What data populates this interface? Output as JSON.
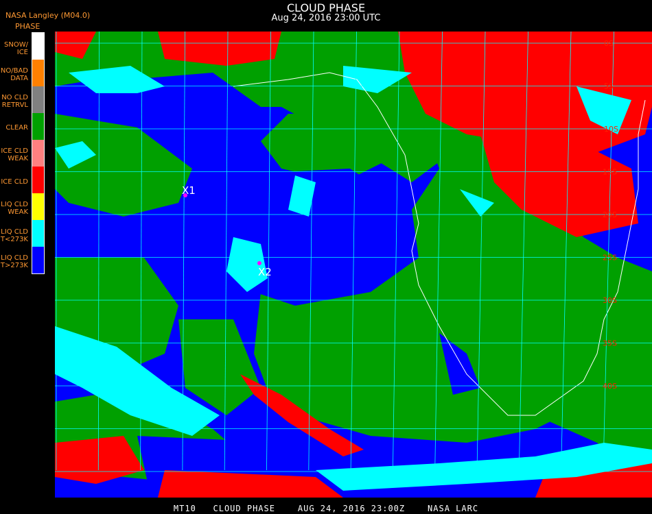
{
  "header": {
    "title": "CLOUD PHASE",
    "subtitle": "Aug 24, 2016 23:00 UTC",
    "producer": "NASA Langley (M04.0)",
    "legend_title": "PHASE"
  },
  "legend": [
    {
      "label": "SNOW/\nICE",
      "color": "#ffffff"
    },
    {
      "label": "NO/BAD\nDATA",
      "color": "#ff8000"
    },
    {
      "label": "NO CLD\nRETRVL",
      "color": "#808080"
    },
    {
      "label": "CLEAR",
      "color": "#00a000"
    },
    {
      "label": "ICE CLD\nWEAK",
      "color": "#ff8080"
    },
    {
      "label": "ICE CLD",
      "color": "#ff0000"
    },
    {
      "label": "LIQ CLD\nWEAK",
      "color": "#ffff00"
    },
    {
      "label": "LIQ CLD\nT<273K",
      "color": "#00ffff"
    },
    {
      "label": "LIQ CLD\nT>273K",
      "color": "#0000ff"
    }
  ],
  "markers": [
    {
      "label": "X1",
      "color": "#ff00ff"
    },
    {
      "label": "X2",
      "color": "#ff00ff"
    }
  ],
  "latitude_labels": [
    "0S",
    "5S",
    "10S",
    "15S",
    "20S",
    "25S",
    "30S",
    "35S",
    "40S"
  ],
  "footer": "MT10   CLOUD PHASE    AUG 24, 2016 23:00Z    NASA LARC"
}
